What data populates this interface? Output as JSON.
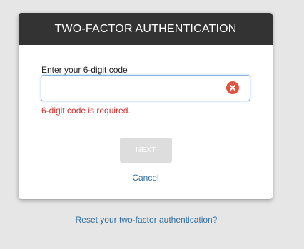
{
  "dialog": {
    "title": "TWO-FACTOR AUTHENTICATION",
    "field_label": "Enter your 6-digit code",
    "code_value": "",
    "error_message": "6-digit code is required.",
    "next_label": "NEXT",
    "cancel_label": "Cancel"
  },
  "footer": {
    "reset_link": "Reset your two-factor authentication?"
  },
  "icons": {
    "clear": "clear-x-circle-icon"
  },
  "colors": {
    "background": "#e6e6e6",
    "header": "#333333",
    "error": "#c9302c",
    "link": "#2f6d9e",
    "clear_icon": "#e0533e",
    "disabled_button": "#dddddd",
    "input_focus_border": "#8ab4de"
  }
}
